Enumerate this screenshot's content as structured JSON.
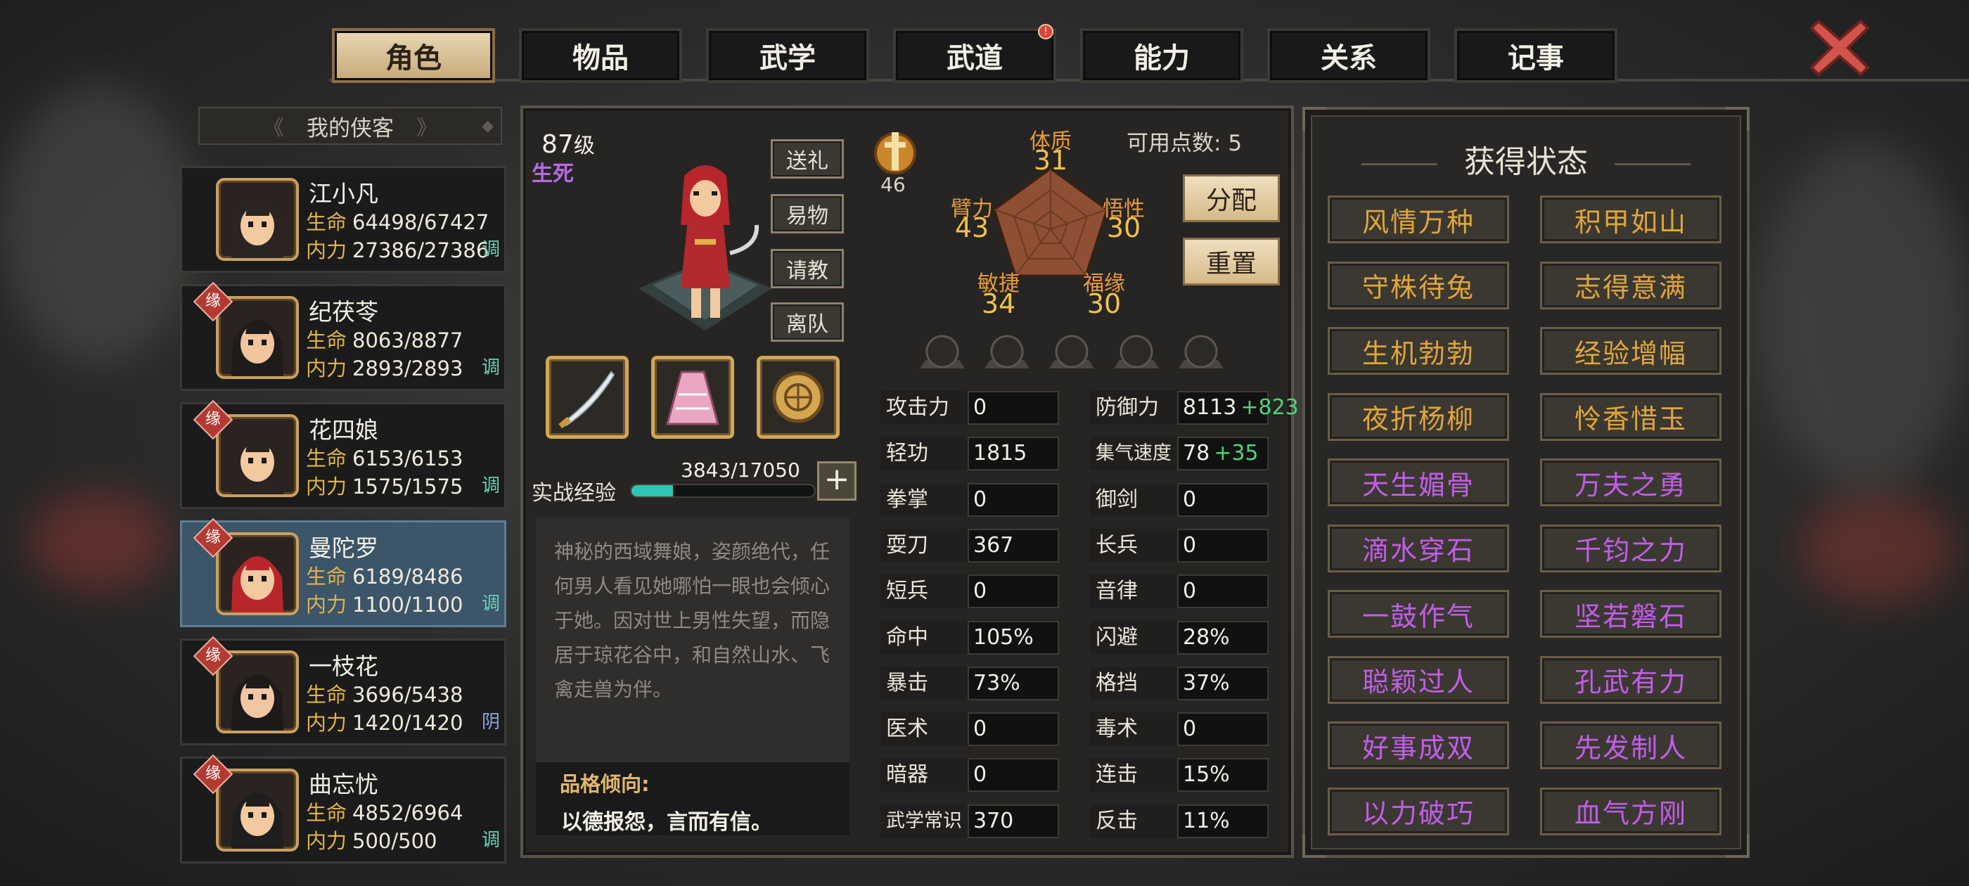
{
  "tabs": [
    {
      "label": "角色",
      "active": true
    },
    {
      "label": "物品",
      "active": false
    },
    {
      "label": "武学",
      "active": false
    },
    {
      "label": "武道",
      "active": false,
      "badge": "!"
    },
    {
      "label": "能力",
      "active": false
    },
    {
      "label": "关系",
      "active": false
    },
    {
      "label": "记事",
      "active": false
    }
  ],
  "roster": {
    "header": "我的侠客",
    "hp_label": "生命",
    "mp_label": "内力",
    "yuan": "缘",
    "items": [
      {
        "name": "江小凡",
        "hp": "64498/67427",
        "mp": "27386/27386",
        "tag": "调",
        "yuan": false,
        "selected": false
      },
      {
        "name": "纪茯苓",
        "hp": "8063/8877",
        "mp": "2893/2893",
        "tag": "调",
        "yuan": true,
        "selected": false
      },
      {
        "name": "花四娘",
        "hp": "6153/6153",
        "mp": "1575/1575",
        "tag": "调",
        "yuan": true,
        "selected": false
      },
      {
        "name": "曼陀罗",
        "hp": "6189/8486",
        "mp": "1100/1100",
        "tag": "调",
        "yuan": true,
        "selected": true
      },
      {
        "name": "一枝花",
        "hp": "3696/5438",
        "mp": "1420/1420",
        "tag": "阴",
        "yuan": true,
        "selected": false
      },
      {
        "name": "曲忘忧",
        "hp": "4852/6964",
        "mp": "500/500",
        "tag": "调",
        "yuan": true,
        "selected": false
      }
    ]
  },
  "character": {
    "level": "87",
    "level_suffix": "级",
    "realm": "生死",
    "actions": [
      "送礼",
      "易物",
      "请教",
      "离队"
    ],
    "exp_label": "实战经验",
    "exp_value": "3843/17050",
    "exp_fraction": 0.225,
    "plus": "+",
    "description": "神秘的西域舞娘，姿颜绝代，任何男人看见她哪怕一眼也会倾心于她。因对世上男性失望，而隐居于琼花谷中，和自然山水、飞禽走兽为伴。",
    "trait_title": "品格倾向:",
    "trait_text": "以德报怨，言而有信。"
  },
  "attributes": {
    "medal_value": "46",
    "points_label": "可用点数:",
    "points_value": "5",
    "allocate": "分配",
    "reset": "重置",
    "stats": [
      {
        "label": "体质",
        "value": "31"
      },
      {
        "label": "臂力",
        "value": "43"
      },
      {
        "label": "悟性",
        "value": "30"
      },
      {
        "label": "敏捷",
        "value": "34"
      },
      {
        "label": "福缘",
        "value": "30"
      }
    ]
  },
  "combat_stats": {
    "left": [
      {
        "label": "攻击力",
        "value": "0"
      },
      {
        "label": "轻功",
        "value": "1815"
      },
      {
        "label": "拳掌",
        "value": "0"
      },
      {
        "label": "耍刀",
        "value": "367"
      },
      {
        "label": "短兵",
        "value": "0"
      },
      {
        "label": "命中",
        "value": "105%"
      },
      {
        "label": "暴击",
        "value": "73%"
      },
      {
        "label": "医术",
        "value": "0"
      },
      {
        "label": "暗器",
        "value": "0"
      },
      {
        "label": "武学常识",
        "value": "370"
      }
    ],
    "right": [
      {
        "label": "防御力",
        "value": "8113",
        "bonus": "+823"
      },
      {
        "label": "集气速度",
        "value": "78",
        "bonus": "+35"
      },
      {
        "label": "御剑",
        "value": "0"
      },
      {
        "label": "长兵",
        "value": "0"
      },
      {
        "label": "音律",
        "value": "0"
      },
      {
        "label": "闪避",
        "value": "28%"
      },
      {
        "label": "格挡",
        "value": "37%"
      },
      {
        "label": "毒术",
        "value": "0"
      },
      {
        "label": "连击",
        "value": "15%"
      },
      {
        "label": "反击",
        "value": "11%"
      }
    ]
  },
  "status_panel": {
    "title": "获得状态",
    "colors": {
      "gold": "#e0a63a",
      "purple": "#c25de8"
    },
    "items": [
      {
        "label": "风情万种",
        "color": "gold"
      },
      {
        "label": "积甲如山",
        "color": "gold"
      },
      {
        "label": "守株待兔",
        "color": "gold"
      },
      {
        "label": "志得意满",
        "color": "gold"
      },
      {
        "label": "生机勃勃",
        "color": "gold"
      },
      {
        "label": "经验增幅",
        "color": "gold"
      },
      {
        "label": "夜折杨柳",
        "color": "gold"
      },
      {
        "label": "怜香惜玉",
        "color": "gold"
      },
      {
        "label": "天生媚骨",
        "color": "purple"
      },
      {
        "label": "万夫之勇",
        "color": "purple"
      },
      {
        "label": "滴水穿石",
        "color": "purple"
      },
      {
        "label": "千钧之力",
        "color": "purple"
      },
      {
        "label": "一鼓作气",
        "color": "purple"
      },
      {
        "label": "坚若磐石",
        "color": "purple"
      },
      {
        "label": "聪颖过人",
        "color": "purple"
      },
      {
        "label": "孔武有力",
        "color": "purple"
      },
      {
        "label": "好事成双",
        "color": "purple"
      },
      {
        "label": "先发制人",
        "color": "purple"
      },
      {
        "label": "以力破巧",
        "color": "purple"
      },
      {
        "label": "血气方刚",
        "color": "purple"
      }
    ]
  }
}
